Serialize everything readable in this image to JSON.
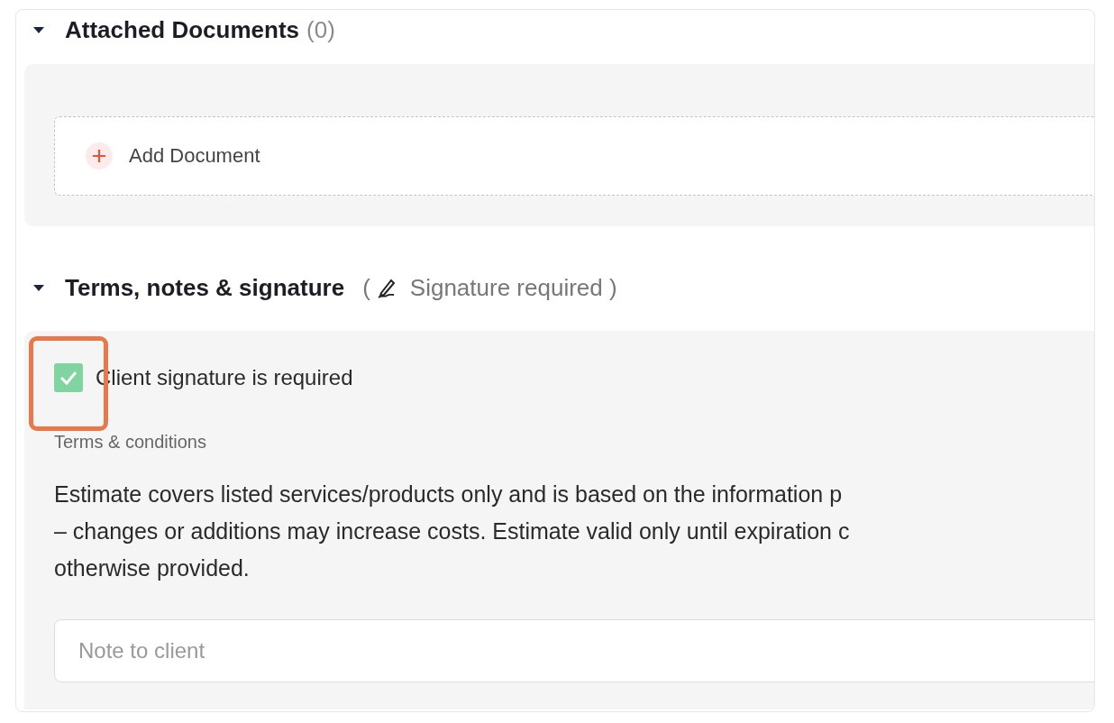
{
  "attachments": {
    "title": "Attached Documents",
    "count": "(0)",
    "expanded": true,
    "add_button": "Add Document"
  },
  "terms_section": {
    "title": "Terms, notes & signature",
    "badge_open": "(",
    "badge_text": "Signature required )",
    "expanded": true,
    "signature_checkbox": {
      "label": "Client signature is required",
      "checked": true
    },
    "terms_label": "Terms & conditions",
    "terms_lines": [
      "Estimate covers listed services/products only and is based on the information p",
      "– changes or additions may increase costs. Estimate valid only until expiration c",
      "otherwise provided."
    ],
    "note_field": {
      "placeholder": "Note to client"
    }
  }
}
